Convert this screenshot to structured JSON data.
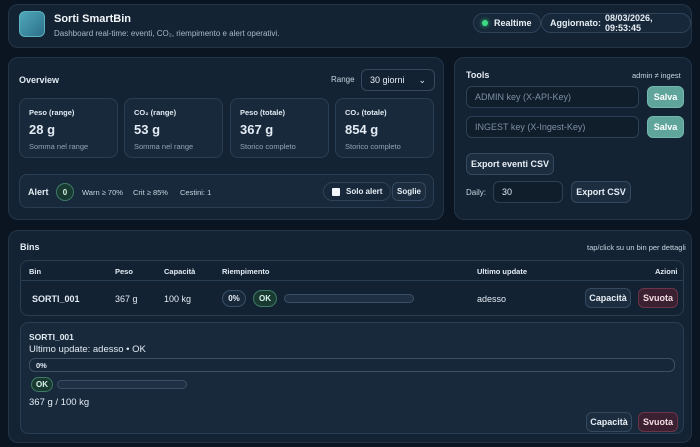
{
  "header": {
    "title": "Sorti SmartBin",
    "subtitle": "Dashboard real-time: eventi, CO₂, riempimento e alert operativi.",
    "realtime_label": "Realtime",
    "updated_label": "Aggiornato:",
    "updated_value": "08/03/2026, 09:53:45",
    "colors": {
      "realtime_dot": "#3ddc84",
      "logo": "#3f8fa8"
    }
  },
  "overview": {
    "title": "Overview",
    "range_label": "Range",
    "range_value": "30 giorni",
    "stats": [
      {
        "label": "Peso (range)",
        "value": "28 g",
        "caption": "Somma nel range"
      },
      {
        "label": "CO₂ (range)",
        "value": "53 g",
        "caption": "Somma nel range"
      },
      {
        "label": "Peso (totale)",
        "value": "367 g",
        "caption": "Storico completo"
      },
      {
        "label": "CO₂ (totale)",
        "value": "854 g",
        "caption": "Storico completo"
      }
    ],
    "alert": {
      "label": "Alert",
      "count": "0",
      "warn": "Warn ≥ 70%",
      "crit": "Crit ≥ 85%",
      "cestini": "Cestini: 1",
      "solo_alert": "Solo alert",
      "soglie": "Soglie"
    }
  },
  "tools": {
    "title": "Tools",
    "role": "admin ≠ ingest",
    "admin_placeholder": "ADMIN key (X-API-Key)",
    "ingest_placeholder": "INGEST key (X-Ingest-Key)",
    "save_label": "Salva",
    "export_events": "Export eventi CSV",
    "daily_label": "Daily:",
    "daily_value": "30",
    "export_csv": "Export CSV"
  },
  "bins": {
    "title": "Bins",
    "hint": "tap/click su un bin per dettagli",
    "columns": [
      "Bin",
      "Peso",
      "Capacità",
      "Riempimento",
      "Ultimo update",
      "Azioni"
    ],
    "rows": [
      {
        "bin": "SORTI_001",
        "peso": "367 g",
        "capacita": "100 kg",
        "fill_percent": "0%",
        "fill_fraction": 0,
        "status": "OK",
        "ultimo_update": "adesso",
        "action_capacity": "Capacità",
        "action_empty": "Svuota"
      }
    ],
    "detail": {
      "name": "SORTI_001",
      "last_update": "Ultimo update: adesso • OK",
      "fill_percent": "0%",
      "status": "OK",
      "weight_capacity": "367 g / 100 kg",
      "action_capacity": "Capacità",
      "action_empty": "Svuota"
    }
  }
}
